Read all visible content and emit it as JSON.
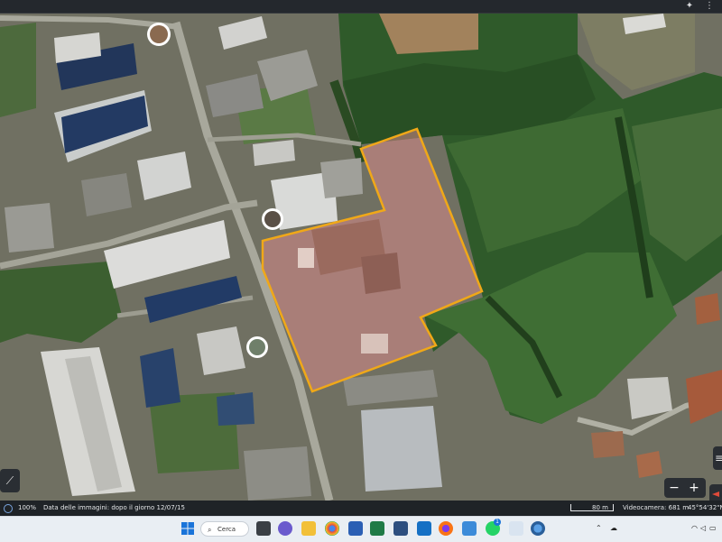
{
  "browser": {
    "extensions_icon": "puzzle-icon",
    "menu_icon": "more-vert-icon"
  },
  "map": {
    "polygon_fill": "#d98a8a",
    "polygon_stroke": "#f0a818",
    "side_left_icon": "elevation-profile-icon",
    "side_right_icon": "layers-icon",
    "zoom_out_label": "−",
    "zoom_in_label": "+",
    "compass_icon": "compass-icon"
  },
  "status": {
    "loading_icon": "loading-ring-icon",
    "percent": "100%",
    "imagery_date": "Data delle immagini: dopo il giorno 12/07/15",
    "scale": "80 m",
    "camera": "Videocamera: 681 m",
    "coords": "45°54'32\"N"
  },
  "taskbar": {
    "search_label": "Cerca",
    "apps": [
      "windows-start-icon",
      "search-icon",
      "file-manager-icon",
      "chat-icon",
      "folder-icon",
      "chrome-icon",
      "word-icon",
      "excel-icon",
      "outlook-icon",
      "firefox-icon",
      "paint-icon",
      "whatsapp-icon",
      "network-icon",
      "earth-icon"
    ],
    "whatsapp_badge": "1",
    "tray_icons": [
      "chevron-up-icon",
      "onedrive-icon",
      "wifi-icon",
      "volume-icon",
      "battery-icon"
    ]
  }
}
